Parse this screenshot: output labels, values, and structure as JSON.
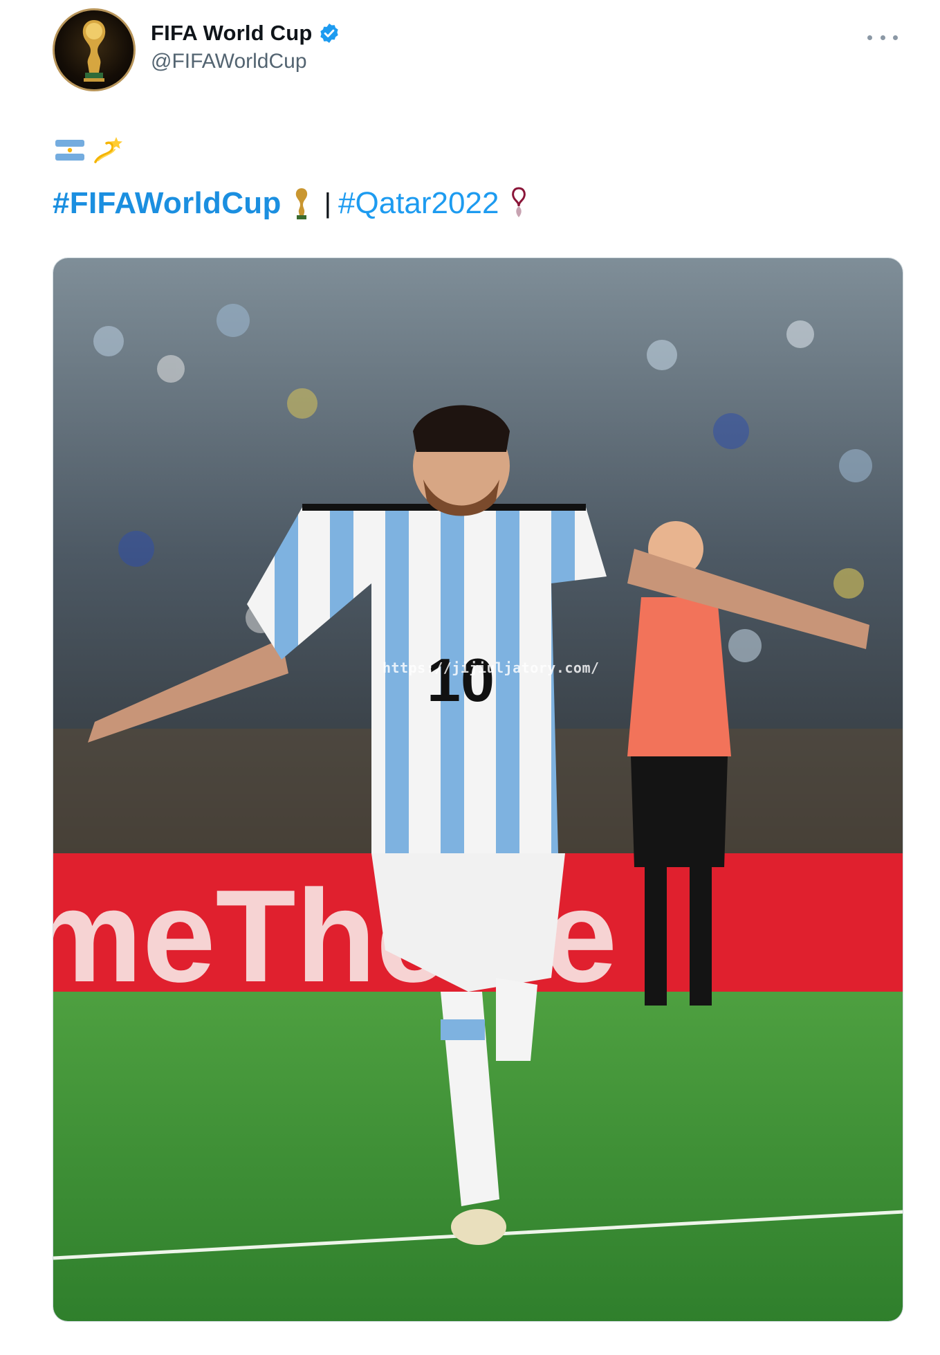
{
  "tweet": {
    "author": {
      "display_name": "FIFA World Cup",
      "handle": "@FIFAWorldCup",
      "verified": true,
      "avatar_icon": "world-cup-trophy-icon"
    },
    "more_icon": "more-options-icon",
    "emoji_line": [
      "argentina-flag-icon",
      "dizzy-emoji-icon"
    ],
    "hashtags": [
      {
        "text": "#FIFAWorldCup",
        "trailing_icon": "trophy-emoji-icon"
      },
      {
        "text": "#Qatar2022",
        "trailing_icon": "qatar2022-emblem-icon"
      }
    ],
    "separator": "|",
    "media": {
      "type": "photo",
      "watermark": "https://jijiuljatory.com/",
      "ad_board_text": "meTheBe",
      "jersey_number": "10",
      "colors": {
        "accent_link": "#1d9bf0",
        "pitch": "#3f9a37",
        "ad_board": "#e0202e",
        "jersey_blue": "#6ea7db",
        "referee_shirt": "#f2735a"
      }
    }
  }
}
